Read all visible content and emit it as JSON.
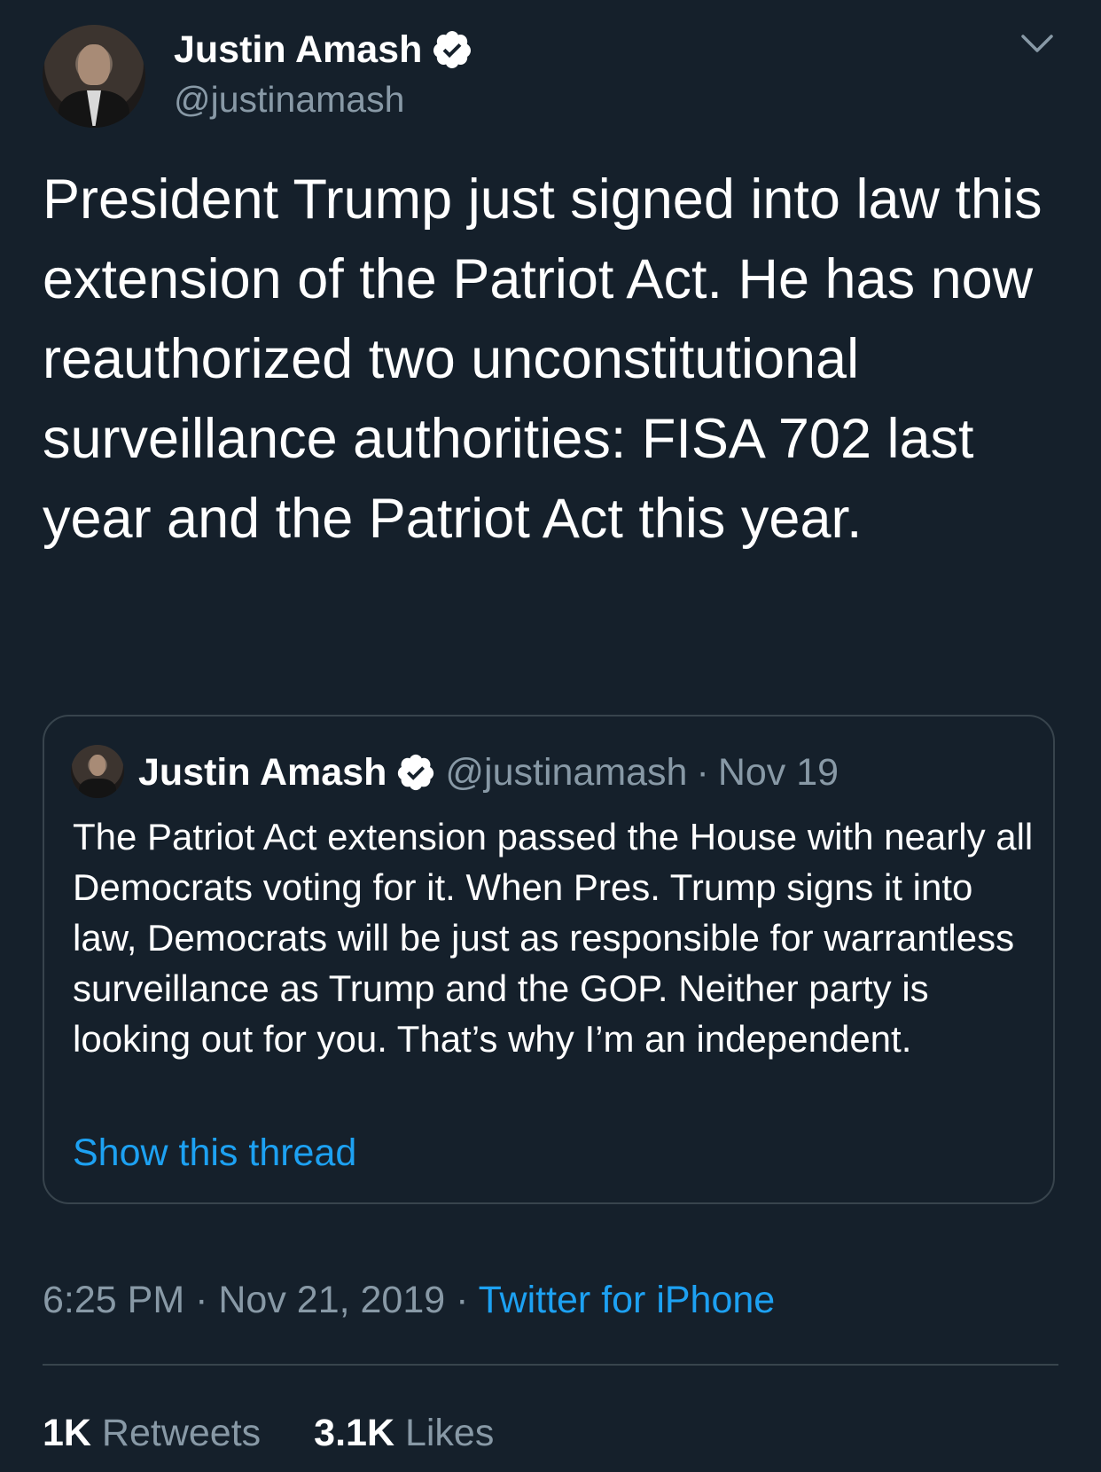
{
  "author": {
    "name": "Justin Amash",
    "handle": "@justinamash"
  },
  "tweet": {
    "text": "President Trump just signed into law this extension of the Patriot Act. He has now reauthorized two unconstitutional surveillance authorities: FISA 702 last year and the Patriot Act this year.",
    "time": "6:25 PM",
    "separator": "·",
    "date": "Nov 21, 2019",
    "source": "Twitter for iPhone"
  },
  "quote": {
    "name": "Justin Amash",
    "handle": "@justinamash",
    "separator": "·",
    "date": "Nov 19",
    "text": "The Patriot Act extension passed the House with nearly all Democrats voting for it. When Pres. Trump signs it into law, Democrats will be just as responsible for warrantless surveillance as Trump and the GOP. Neither party is looking out for you. That’s why I’m an independent.",
    "show_thread": "Show this thread"
  },
  "stats": {
    "retweets_count": "1K",
    "retweets_label": "Retweets",
    "likes_count": "3.1K",
    "likes_label": "Likes"
  },
  "colors": {
    "background": "#15202b",
    "secondary_text": "#8899a6",
    "link": "#1da1f2",
    "border": "#38444d"
  },
  "icons": {
    "verified": "verified-badge-icon",
    "more": "chevron-down-icon"
  }
}
